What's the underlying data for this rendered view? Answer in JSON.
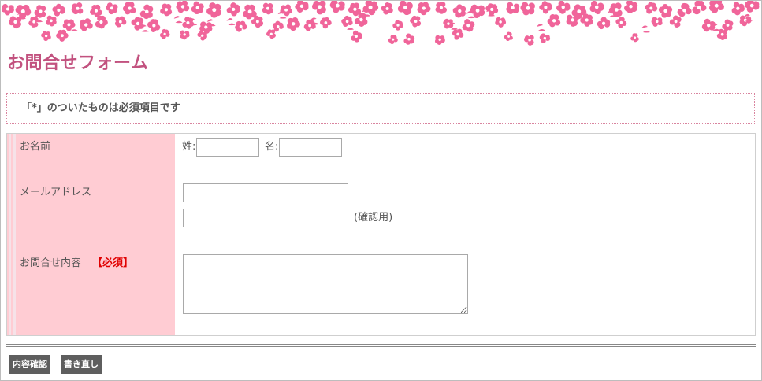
{
  "page": {
    "title": "お問合せフォーム"
  },
  "notice": {
    "text": "「*」のついたものは必須項目です"
  },
  "form": {
    "name": {
      "label": "お名前",
      "last_label": "姓:",
      "first_label": "名:",
      "last_value": "",
      "first_value": ""
    },
    "email": {
      "label": "メールアドレス",
      "value": "",
      "confirm_value": "",
      "confirm_note": "(確認用)"
    },
    "inquiry": {
      "label": "お問合せ内容",
      "required": "【必須】",
      "value": ""
    }
  },
  "buttons": {
    "confirm": "内容確認",
    "reset": "書き直し"
  },
  "colors": {
    "title": "#c2527f",
    "label_bg": "#ffccd3",
    "required": "#e00000",
    "button_bg": "#5e5e5e",
    "flower": "#f0659a"
  }
}
